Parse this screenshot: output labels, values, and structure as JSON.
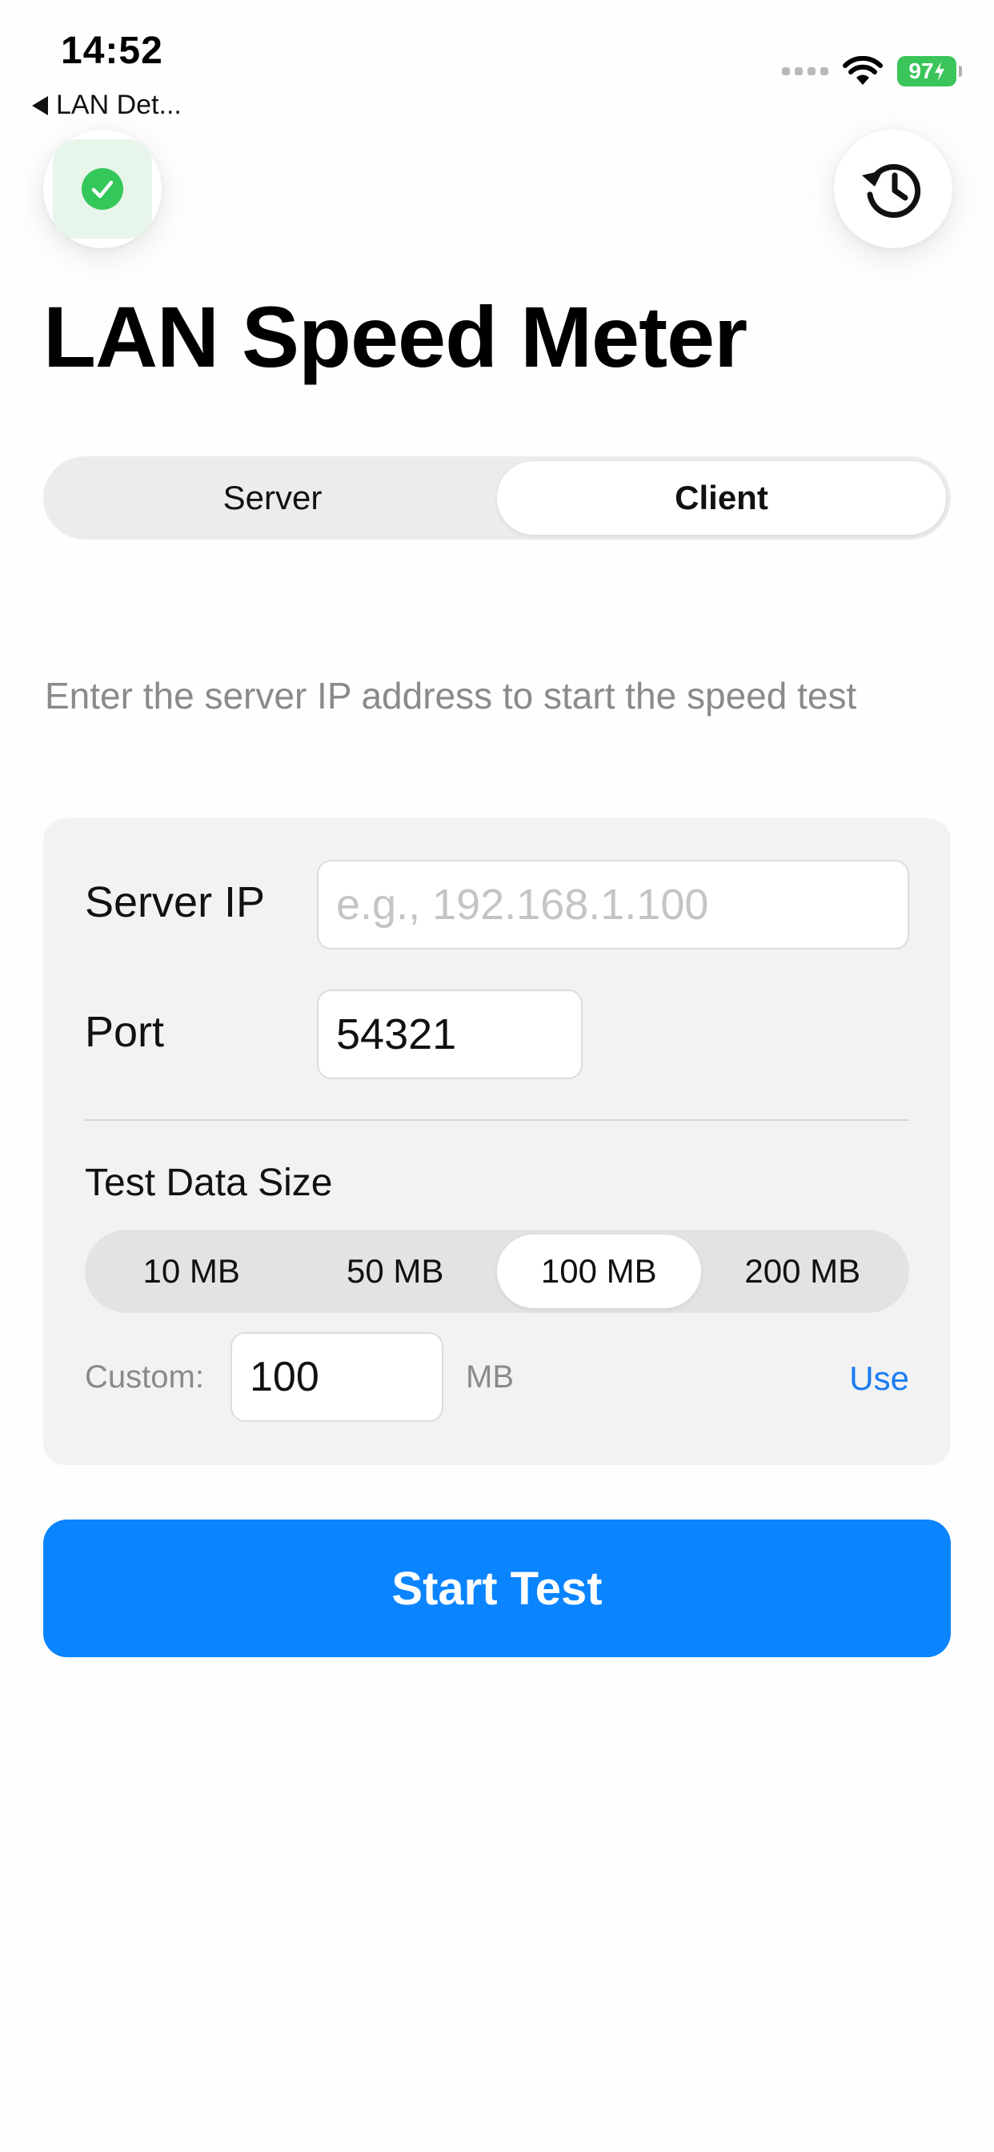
{
  "status_bar": {
    "time": "14:52",
    "back_label": "LAN Det...",
    "battery": "97"
  },
  "icons": {
    "status": "checkmark-circle-icon",
    "history": "history-clock-icon",
    "wifi": "wifi-icon"
  },
  "page": {
    "title": "LAN Speed Meter",
    "instruction": "Enter the server IP address to start the speed test"
  },
  "mode_tabs": [
    {
      "label": "Server",
      "selected": false
    },
    {
      "label": "Client",
      "selected": true
    }
  ],
  "form": {
    "server_ip_label": "Server IP",
    "server_ip_placeholder": "e.g., 192.168.1.100",
    "server_ip_value": "",
    "port_label": "Port",
    "port_value": "54321",
    "test_data_size_label": "Test Data Size",
    "size_options": [
      {
        "label": "10 MB",
        "selected": false
      },
      {
        "label": "50 MB",
        "selected": false
      },
      {
        "label": "100 MB",
        "selected": true
      },
      {
        "label": "200 MB",
        "selected": false
      }
    ],
    "custom_label": "Custom:",
    "custom_value": "100",
    "custom_unit": "MB",
    "use_label": "Use"
  },
  "actions": {
    "start_label": "Start Test"
  },
  "colors": {
    "accent": "#0a84ff",
    "link": "#1a7cf0",
    "success": "#34c759",
    "battery": "#3ac45a"
  }
}
